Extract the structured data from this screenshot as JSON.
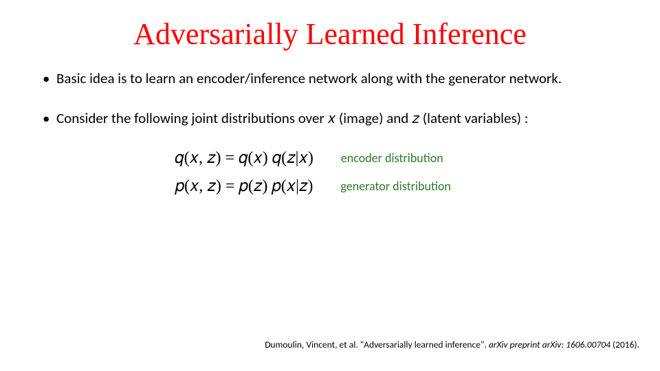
{
  "title": "Adversarially Learned Inference",
  "bullets": [
    "Basic idea is to learn an encoder/inference network along with the generator network.",
    "Consider the following joint distributions over 𝑥 (image) and 𝑧 (latent variables) :"
  ],
  "equations": {
    "e1": "𝑞(𝑥, 𝑧)  =   𝑞(𝑥) 𝑞(𝑧|𝑥)",
    "a1": "encoder distribution",
    "e2": "𝑝(𝑥, 𝑧) =   𝑝(𝑧) 𝑝(𝑥|𝑧)",
    "a2": "generator distribution"
  },
  "citation": {
    "pre": "Dumoulin, Vincent, et al. \"Adversarially learned inference\". ",
    "ital": "arXiv preprint arXiv: 1606.00704 ",
    "post": "(2016)."
  }
}
